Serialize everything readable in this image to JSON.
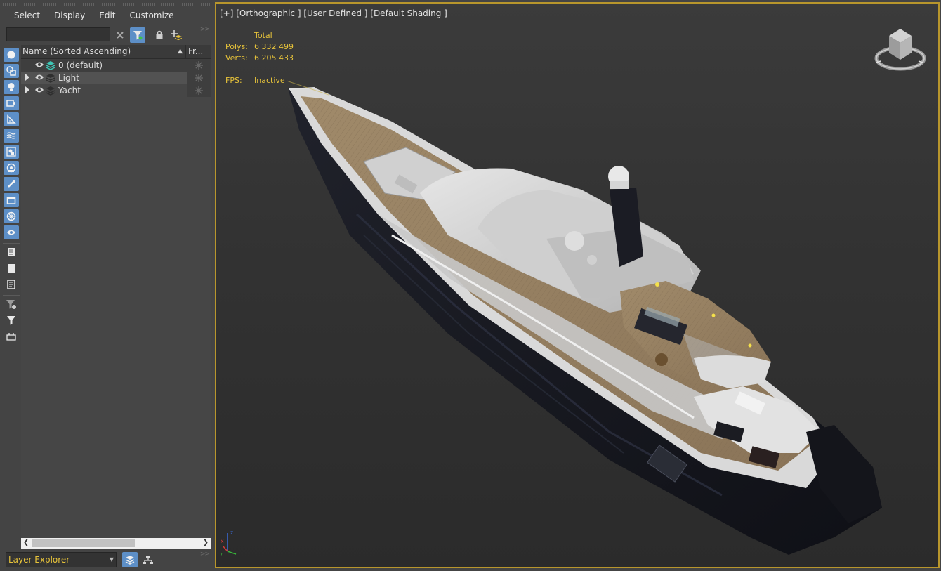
{
  "menu": [
    "Select",
    "Display",
    "Edit",
    "Customize"
  ],
  "search": {
    "value": "",
    "placeholder": ""
  },
  "tree": {
    "columns": {
      "name": "Name (Sorted Ascending)",
      "frozen": "Fr..."
    },
    "rows": [
      {
        "label": "0 (default)",
        "active": true,
        "expandable": false
      },
      {
        "label": "Light",
        "active": false,
        "expandable": true
      },
      {
        "label": "Yacht",
        "active": false,
        "expandable": true
      }
    ]
  },
  "explorer_mode": "Layer Explorer",
  "viewport": {
    "label": "[+] [Orthographic ] [User Defined ] [Default Shading ]",
    "stats": {
      "header": "Total",
      "polys_label": "Polys:",
      "polys": "6 332 499",
      "verts_label": "Verts:",
      "verts": "6 205 433",
      "fps_label": "FPS:",
      "fps": "Inactive"
    }
  },
  "colors": {
    "accent": "#5d8fc7",
    "viewport_border": "#b8962c",
    "stats_text": "#e7c33a"
  },
  "icons": {
    "side_toolbar": [
      "geometry-icon",
      "shapes-icon",
      "lights-icon",
      "cameras-icon",
      "helpers-icon",
      "space-warps-icon",
      "groups-icon",
      "xrefs-icon",
      "bones-icon",
      "containers-icon",
      "frozen-icon",
      "hidden-icon",
      "display-all-icon",
      "display-none-icon",
      "invert-display-icon",
      "filter-settings-icon",
      "selection-filter-icon",
      "select-dependents-icon"
    ]
  }
}
